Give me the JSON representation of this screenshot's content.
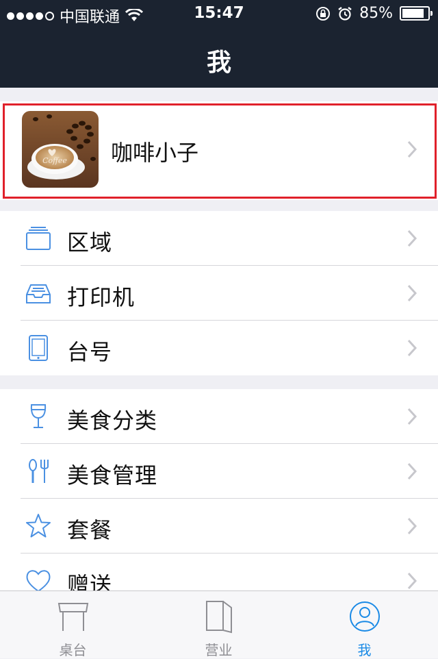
{
  "status_bar": {
    "carrier": "中国联通",
    "time": "15:47",
    "battery": "85%",
    "battery_level": 0.85
  },
  "header": {
    "title": "我"
  },
  "profile": {
    "name": "咖啡小子",
    "avatar_text": "Coffee"
  },
  "groups": [
    {
      "items": [
        {
          "label": "区域",
          "icon": "tray-icon"
        },
        {
          "label": "打印机",
          "icon": "inbox-tray-icon"
        },
        {
          "label": "台号",
          "icon": "tablet-icon"
        }
      ]
    },
    {
      "items": [
        {
          "label": "美食分类",
          "icon": "wine-glass-icon"
        },
        {
          "label": "美食管理",
          "icon": "utensils-icon"
        },
        {
          "label": "套餐",
          "icon": "star-icon"
        },
        {
          "label": "赠送",
          "icon": "heart-icon"
        }
      ]
    }
  ],
  "tabbar": {
    "tabs": [
      {
        "label": "桌台",
        "icon": "table-icon",
        "active": false
      },
      {
        "label": "营业",
        "icon": "book-icon",
        "active": false
      },
      {
        "label": "我",
        "icon": "user-icon",
        "active": true
      }
    ]
  },
  "colors": {
    "header_bg": "#1b2330",
    "accent": "#1a8ae6",
    "highlight_frame": "#e0202a",
    "icon_blue": "#4a90e2"
  }
}
